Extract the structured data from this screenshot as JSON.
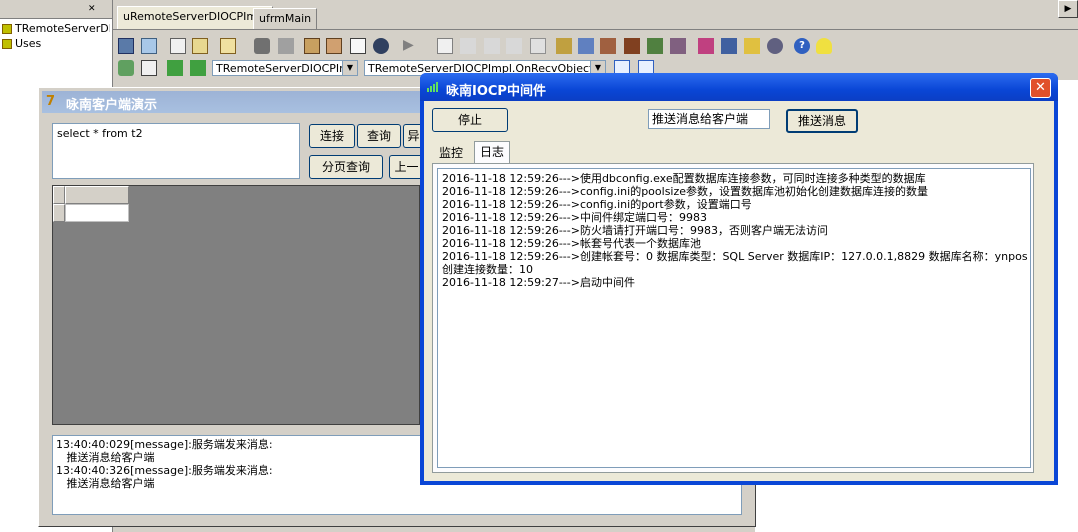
{
  "ide": {
    "tree_items": [
      "TRemoteServerDIOCPImpl",
      "Uses"
    ],
    "tabs": [
      "uRemoteServerDIOCPImpl",
      "ufrmMain"
    ],
    "class_combo": "TRemoteServerDIOCPImpl",
    "method_combo": "TRemoteServerDIOCPImpl.OnRecvObject",
    "scroll_right_glyph": "▶"
  },
  "client": {
    "title": "咏南客户端演示",
    "sql_text": "select * from t2",
    "buttons": {
      "connect": "连接",
      "query": "查询",
      "async": "异",
      "page_query": "分页查询",
      "prev": "上一"
    },
    "log_lines": [
      "13:40:40:029[message]:服务端发来消息:",
      "   推送消息给客户端",
      "13:40:40:326[message]:服务端发来消息:",
      "   推送消息给客户端"
    ]
  },
  "iocp": {
    "title": "咏南IOCP中间件",
    "close_glyph": "✕",
    "stop_label": "停止",
    "push_input_value": "推送消息给客户端",
    "push_button": "推送消息",
    "tabs": [
      "监控",
      "日志"
    ],
    "active_tab": "日志",
    "log_lines": [
      "2016-11-18 12:59:26--->使用dbconfig.exe配置数据库连接参数，可同时连接多种类型的数据库",
      "2016-11-18 12:59:26--->config.ini的poolsize参数，设置数据库池初始化创建数据库连接的数量",
      "2016-11-18 12:59:26--->config.ini的port参数，设置端口号",
      "2016-11-18 12:59:26--->中间件绑定端口号：9983",
      "2016-11-18 12:59:26--->防火墙请打开端口号：9983，否则客户端无法访问",
      "2016-11-18 12:59:26--->帐套号代表一个数据库池",
      "2016-11-18 12:59:26--->创建帐套号：0 数据库类型：SQL Server 数据库IP：127.0.0.1,8829 数据库名称：ynpos",
      "创建连接数量：10",
      "2016-11-18 12:59:27--->启动中间件"
    ]
  },
  "colors": {
    "xp_blue": "#0a46d6",
    "close_red": "#e1502a",
    "face": "#d4d0c8"
  }
}
